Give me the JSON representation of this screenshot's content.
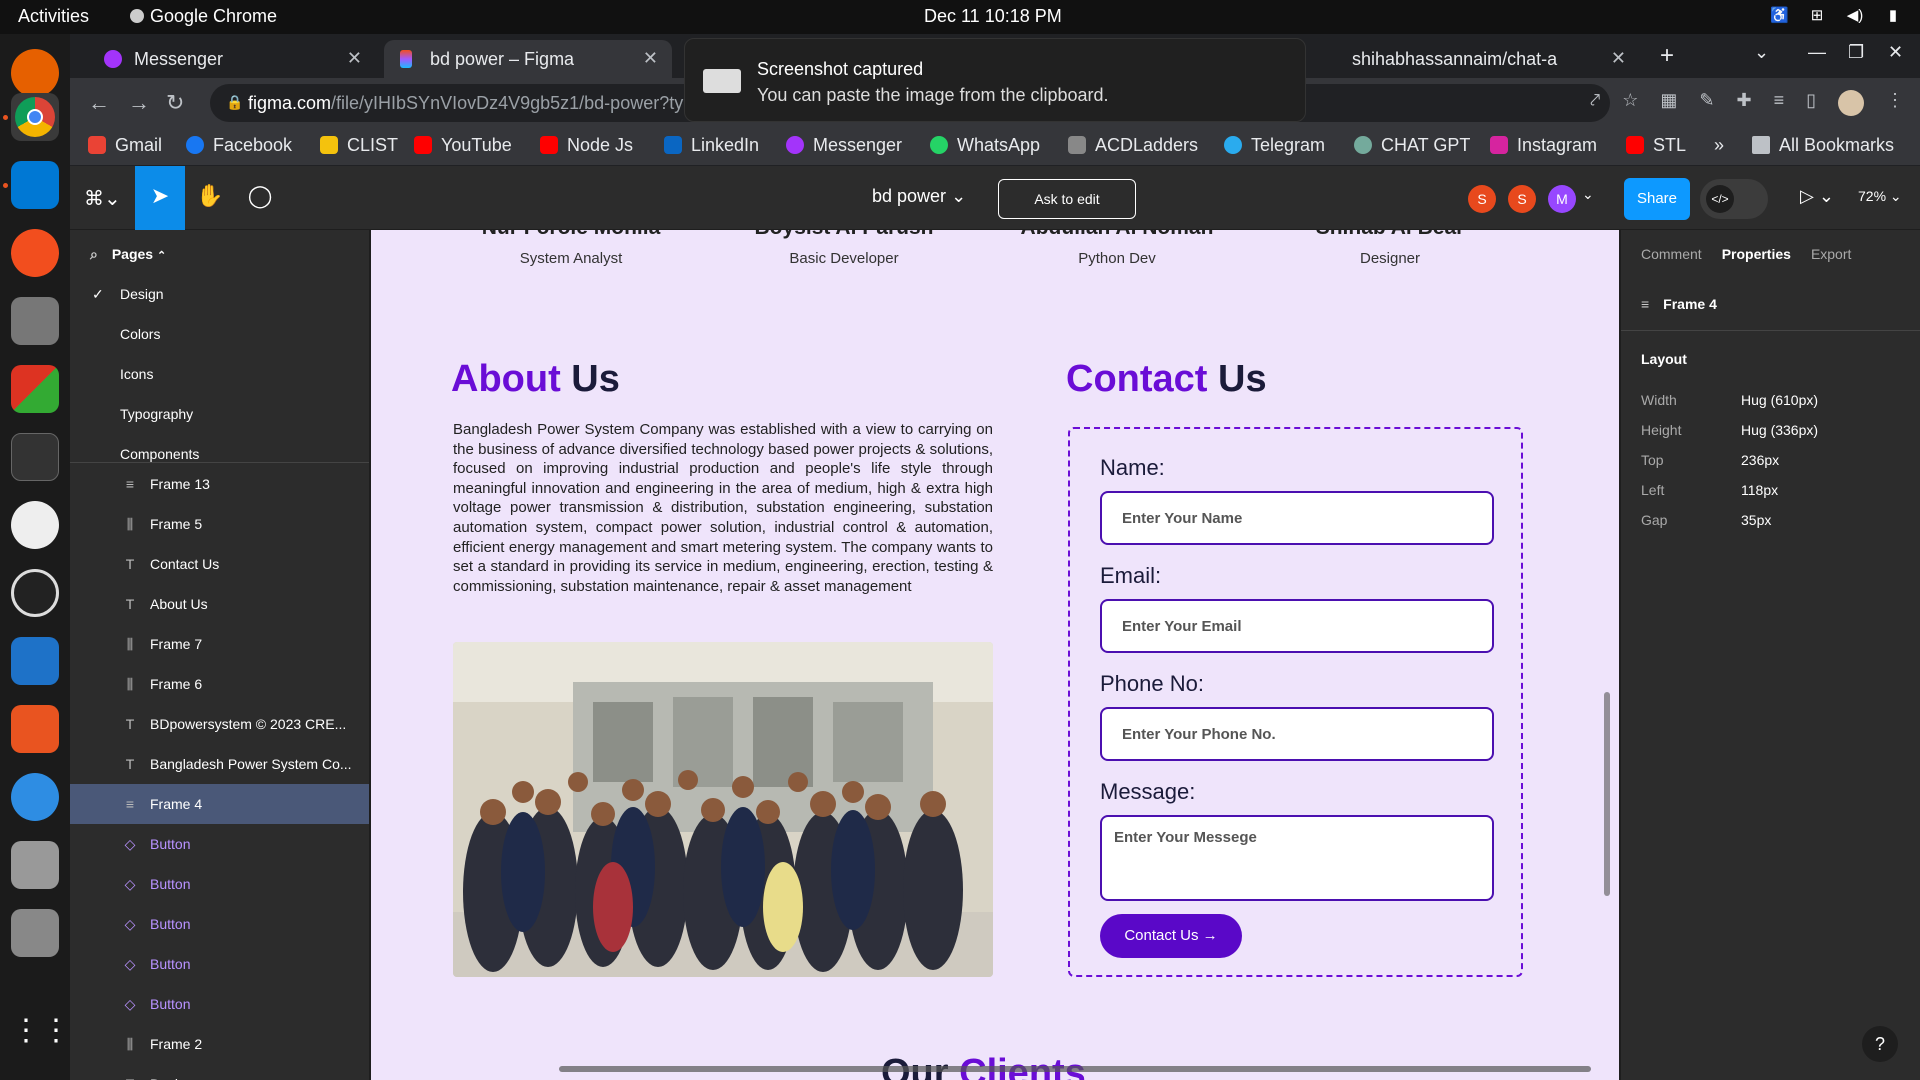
{
  "system": {
    "activities": "Activities",
    "app_name": "Google Chrome",
    "clock": "Dec 11  10:18 PM"
  },
  "browser": {
    "tabs": [
      {
        "title": "Messenger",
        "active": false
      },
      {
        "title": "bd power – Figma",
        "active": true
      },
      {
        "title": "shihabhassannaim/chat-a",
        "active": false
      }
    ],
    "url_host": "figma.com",
    "url_path": "/file/yIHIbSYnVIovDz4V9gb5z1/bd-power?ty",
    "bookmarks": [
      "Gmail",
      "Facebook",
      "CLIST",
      "YouTube",
      "Node Js",
      "LinkedIn",
      "Messenger",
      "WhatsApp",
      "ACDLadders",
      "Telegram",
      "CHAT GPT",
      "Instagram",
      "STL"
    ],
    "more_bookmarks": "»",
    "all_bookmarks": "All Bookmarks"
  },
  "toast": {
    "title": "Screenshot captured",
    "body": "You can paste the image from the clipboard."
  },
  "figma": {
    "file_name": "bd power",
    "ask_to_edit": "Ask to edit",
    "avatars": [
      "S",
      "S",
      "M"
    ],
    "share": "Share",
    "zoom": "72%",
    "pages_label": "Pages",
    "pages": [
      "Design",
      "Colors",
      "Icons",
      "Typography",
      "Components"
    ],
    "layers": [
      {
        "name": "Frame 13",
        "icon": "autolayout-icon"
      },
      {
        "name": "Frame 5",
        "icon": "column-icon"
      },
      {
        "name": "Contact Us",
        "icon": "text-icon"
      },
      {
        "name": "About Us",
        "icon": "text-icon"
      },
      {
        "name": "Frame 7",
        "icon": "column-icon"
      },
      {
        "name": "Frame 6",
        "icon": "column-icon"
      },
      {
        "name": "BDpowersystem © 2023 CRE...",
        "icon": "text-icon"
      },
      {
        "name": "Bangladesh Power System Co...",
        "icon": "text-icon"
      },
      {
        "name": "Frame 4",
        "icon": "autolayout-icon",
        "selected": true
      },
      {
        "name": "Button",
        "icon": "component-icon"
      },
      {
        "name": "Button",
        "icon": "component-icon"
      },
      {
        "name": "Button",
        "icon": "component-icon"
      },
      {
        "name": "Button",
        "icon": "component-icon"
      },
      {
        "name": "Button",
        "icon": "component-icon"
      },
      {
        "name": "Frame 2",
        "icon": "column-icon"
      },
      {
        "name": "Designer",
        "icon": "text-icon"
      }
    ],
    "right_tabs": [
      "Comment",
      "Properties",
      "Export"
    ],
    "selection": "Frame 4",
    "layout_label": "Layout",
    "properties": [
      {
        "key": "Width",
        "value": "Hug (610px)"
      },
      {
        "key": "Height",
        "value": "Hug (336px)"
      },
      {
        "key": "Top",
        "value": "236px"
      },
      {
        "key": "Left",
        "value": "118px"
      },
      {
        "key": "Gap",
        "value": "35px"
      }
    ]
  },
  "design": {
    "team": [
      {
        "name": "Nur Forole Mohila",
        "role": "System Analyst"
      },
      {
        "name": "Boysist Al Parush",
        "role": "Basic Developer"
      },
      {
        "name": "Abdullah Al Noman",
        "role": "Python Dev"
      },
      {
        "name": "Shihab Al Bear",
        "role": "Designer"
      }
    ],
    "about_accent": "About",
    "about_rest": " Us",
    "about_text": "Bangladesh Power System Company was established with a view to carrying on the business of advance diversified technology based power projects & solutions, focused on improving industrial production and people's life style through meaningful innovation and engineering in the area of medium, high & extra high voltage power transmission & distribution, substation engineering, substation automation system, compact power solution, industrial control & automation, efficient energy management and smart metering system. The company wants to set a standard in providing its service in medium, engineering, erection, testing & commissioning, substation maintenance, repair & asset management",
    "contact_accent": "Contact",
    "contact_rest": " Us",
    "form": {
      "name_label": "Name:",
      "name_placeholder": "Enter Your Name",
      "email_label": "Email:",
      "email_placeholder": "Enter Your Email",
      "phone_label": "Phone No:",
      "phone_placeholder": "Enter Your Phone No.",
      "message_label": "Message:",
      "message_placeholder": "Enter Your Messege",
      "button": "Contact Us →"
    },
    "clients_rest": "Our ",
    "clients_accent": "Clients"
  },
  "colors": {
    "accent": "#6a0dd6",
    "canvas_bg": "#efe4fb",
    "figma_blue": "#0d99ff"
  }
}
